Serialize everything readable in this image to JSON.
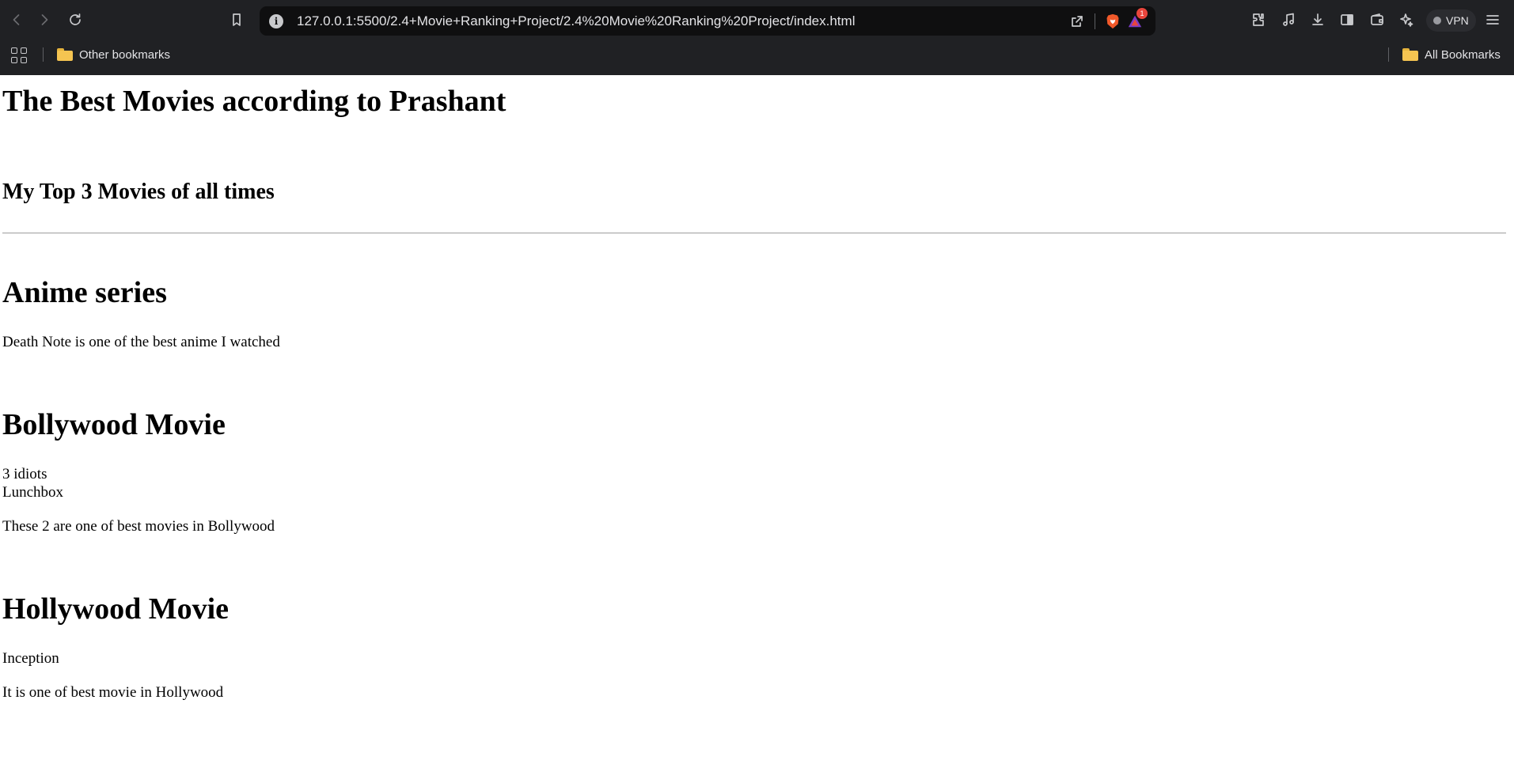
{
  "browser": {
    "url": "127.0.0.1:5500/2.4+Movie+Ranking+Project/2.4%20Movie%20Ranking%20Project/index.html",
    "rewards_badge": "1",
    "vpn_label": "VPN",
    "bookmarks_bar": {
      "other_bookmarks": "Other bookmarks",
      "all_bookmarks": "All Bookmarks"
    }
  },
  "page": {
    "title": "The Best Movies according to Prashant",
    "subtitle": "My Top 3 Movies of all times",
    "sections": [
      {
        "heading": "Anime series",
        "lines": [
          "Death Note is one of the best anime I watched"
        ]
      },
      {
        "heading": "Bollywood Movie",
        "lines": [
          "3 idiots",
          "Lunchbox",
          "These 2 are one of best movies in Bollywood"
        ]
      },
      {
        "heading": "Hollywood Movie",
        "lines": [
          "Inception",
          "It is one of best movie in Hollywood"
        ]
      }
    ]
  }
}
